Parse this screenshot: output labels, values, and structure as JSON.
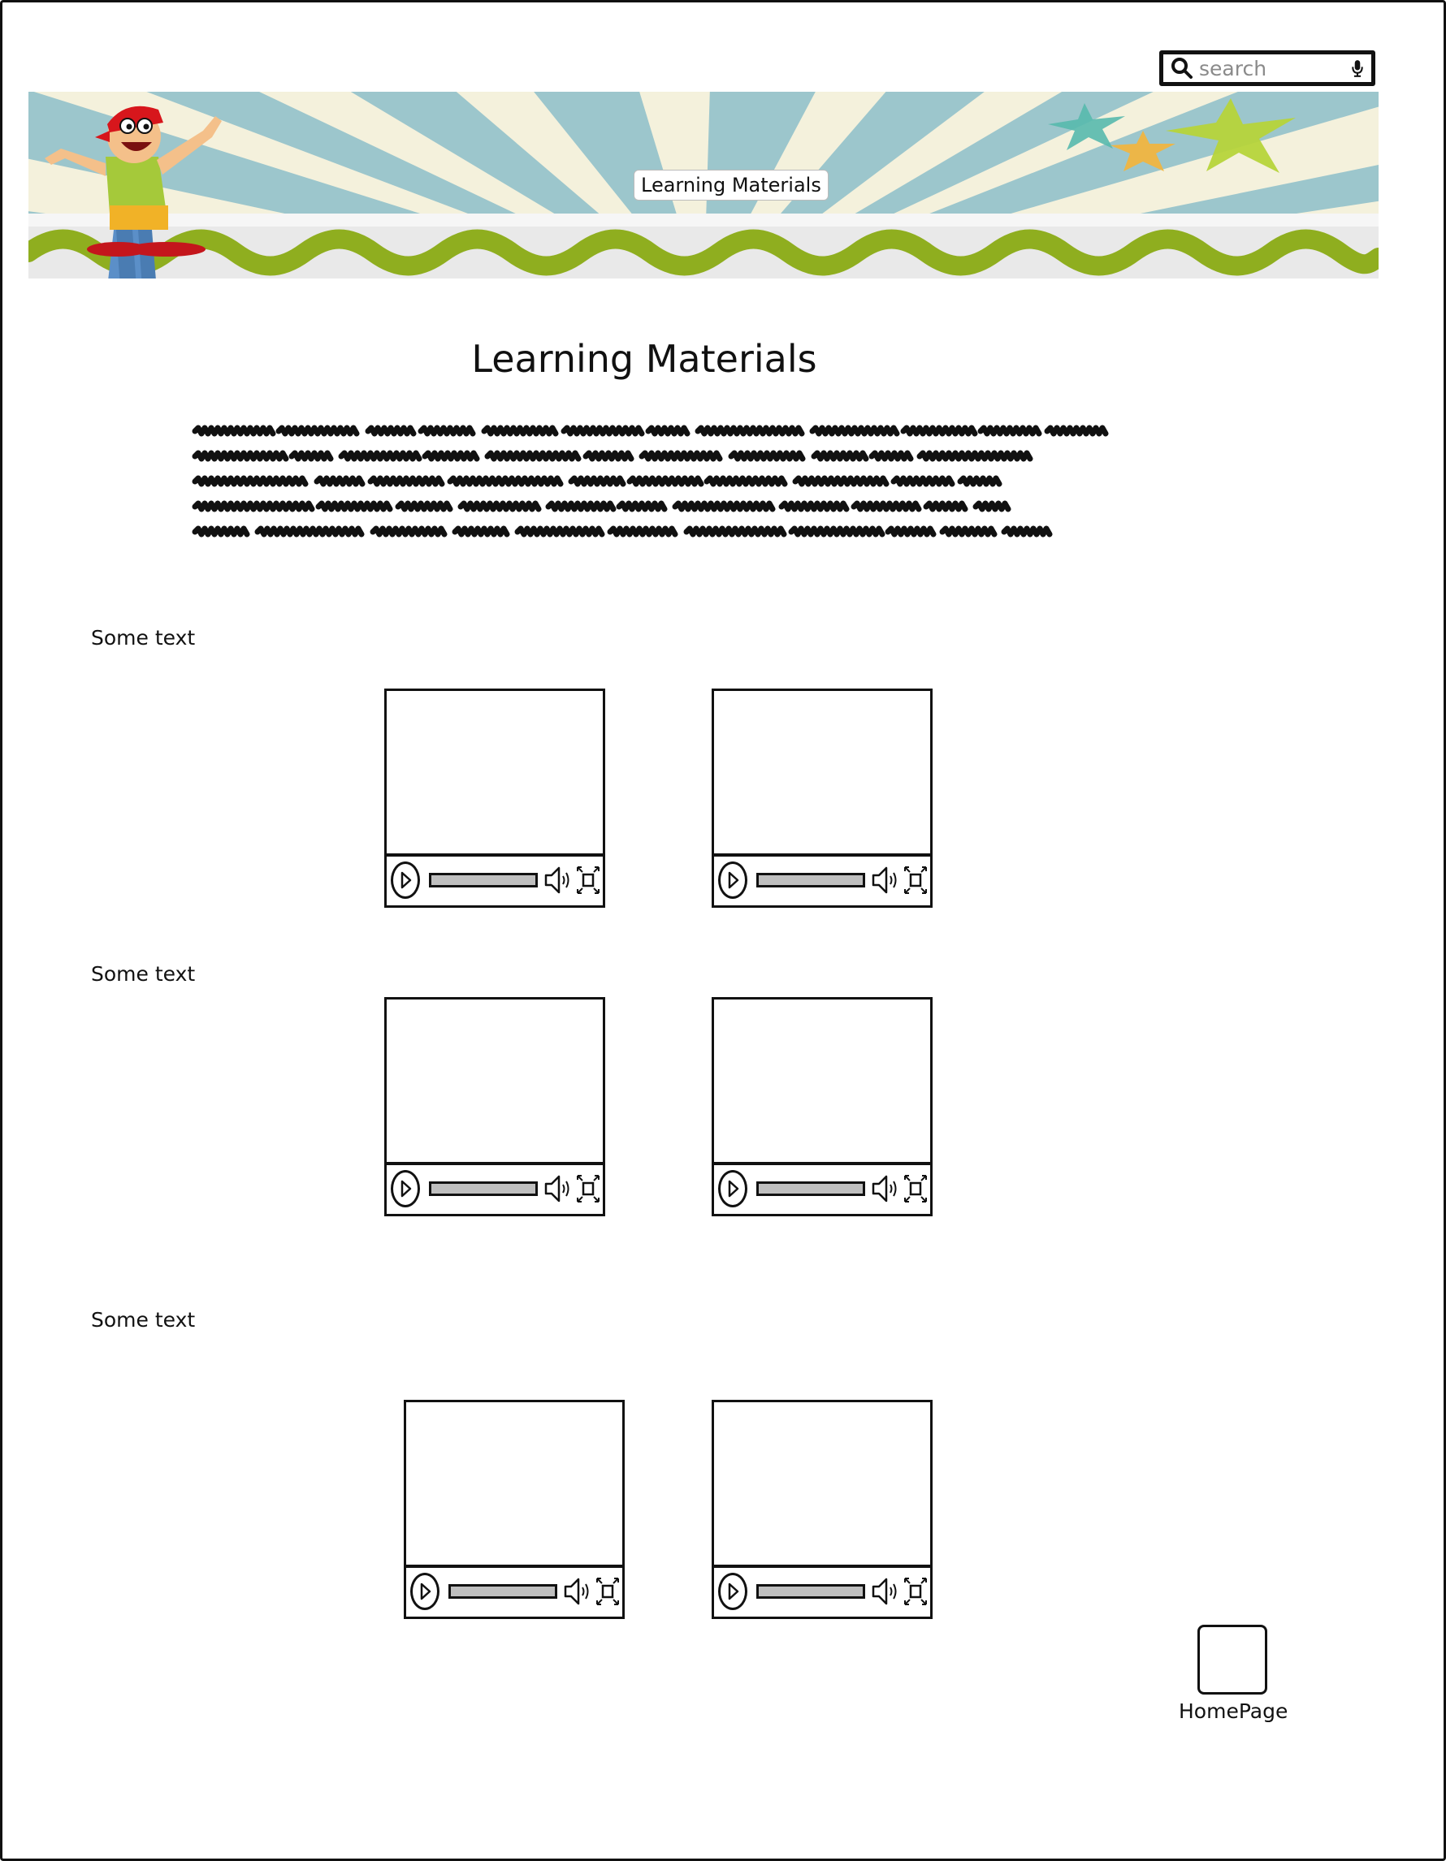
{
  "search": {
    "placeholder": "search"
  },
  "banner": {
    "label": "Learning Materials"
  },
  "page_title": "Learning Materials",
  "intro": {
    "text": ""
  },
  "sections": [
    {
      "label": "Some text"
    },
    {
      "label": "Some text"
    },
    {
      "label": "Some text"
    }
  ],
  "videos": [
    {
      "progress": 1.0
    },
    {
      "progress": 1.0
    },
    {
      "progress": 1.0
    },
    {
      "progress": 1.0
    },
    {
      "progress": 1.0
    },
    {
      "progress": 1.0
    }
  ],
  "homepage": {
    "label": "HomePage"
  },
  "colors": {
    "border": "#111111",
    "banner_sky": "#9cc6cc",
    "banner_ray": "#f4f1dc",
    "ribbon_green": "#8fae1f",
    "progress_gray": "#bfbfbf"
  },
  "icons": [
    "search-icon",
    "microphone-icon",
    "play-icon",
    "volume-icon",
    "fullscreen-icon",
    "cartoon-boy-image",
    "star-decoration"
  ]
}
